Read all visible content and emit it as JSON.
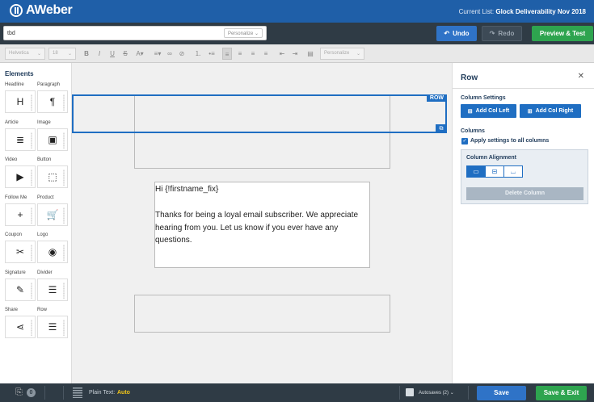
{
  "header": {
    "logo_text": "AWeber",
    "current_list_label": "Current List:",
    "current_list_value": "Glock Deliverability Nov 2018"
  },
  "subbar": {
    "subject_value": "tbd",
    "personalize_label": "Personalize",
    "undo_label": "Undo",
    "redo_label": "Redo",
    "preview_label": "Preview & Test"
  },
  "toolbar": {
    "font_family": "Helvetica",
    "font_size": "18",
    "personalize_label": "Personalize"
  },
  "elements_panel": {
    "title": "Elements",
    "items": [
      {
        "label": "Headline",
        "icon": "headline-icon",
        "glyph": "H"
      },
      {
        "label": "Paragraph",
        "icon": "paragraph-icon",
        "glyph": "¶"
      },
      {
        "label": "Article",
        "icon": "article-icon",
        "glyph": "≣"
      },
      {
        "label": "Image",
        "icon": "image-icon",
        "glyph": "▣"
      },
      {
        "label": "Video",
        "icon": "video-icon",
        "glyph": "▶"
      },
      {
        "label": "Button",
        "icon": "button-icon",
        "glyph": "⬚"
      },
      {
        "label": "Follow Me",
        "icon": "follow-me-icon",
        "glyph": "+"
      },
      {
        "label": "Product",
        "icon": "product-icon",
        "glyph": "🛒"
      },
      {
        "label": "Coupon",
        "icon": "coupon-icon",
        "glyph": "✂"
      },
      {
        "label": "Logo",
        "icon": "logo-icon",
        "glyph": "◉"
      },
      {
        "label": "Signature",
        "icon": "signature-icon",
        "glyph": "✎"
      },
      {
        "label": "Divider",
        "icon": "divider-icon",
        "glyph": "☰"
      },
      {
        "label": "Share",
        "icon": "share-icon",
        "glyph": "⋖"
      },
      {
        "label": "Row",
        "icon": "row-icon",
        "glyph": "☰"
      }
    ]
  },
  "canvas": {
    "row_badge": "ROW",
    "greeting": "Hi {!firstname_fix}",
    "body": "Thanks for being a loyal email subscriber. We appreciate hearing from you. Let us know if you ever have any questions."
  },
  "row_panel": {
    "title": "Row",
    "column_settings_label": "Column Settings",
    "add_col_left": "Add Col Left",
    "add_col_right": "Add Col Right",
    "columns_label": "Columns",
    "apply_all_label": "Apply settings to all columns",
    "apply_all_checked": true,
    "alignment_label": "Column Alignment",
    "alignment_selected": "top",
    "delete_column_label": "Delete Column"
  },
  "footer": {
    "attachments_count": "0",
    "plain_text_label": "Plain Text:",
    "plain_text_value": "Auto",
    "autosaves_label": "Autosaves (2)",
    "save_label": "Save",
    "save_exit_label": "Save & Exit"
  },
  "colors": {
    "brand_blue": "#1f5fa8",
    "action_blue": "#2f73c7",
    "success_green": "#2ea44f",
    "dark_bar": "#2f3b45",
    "plain_text_accent": "#f0c419"
  }
}
